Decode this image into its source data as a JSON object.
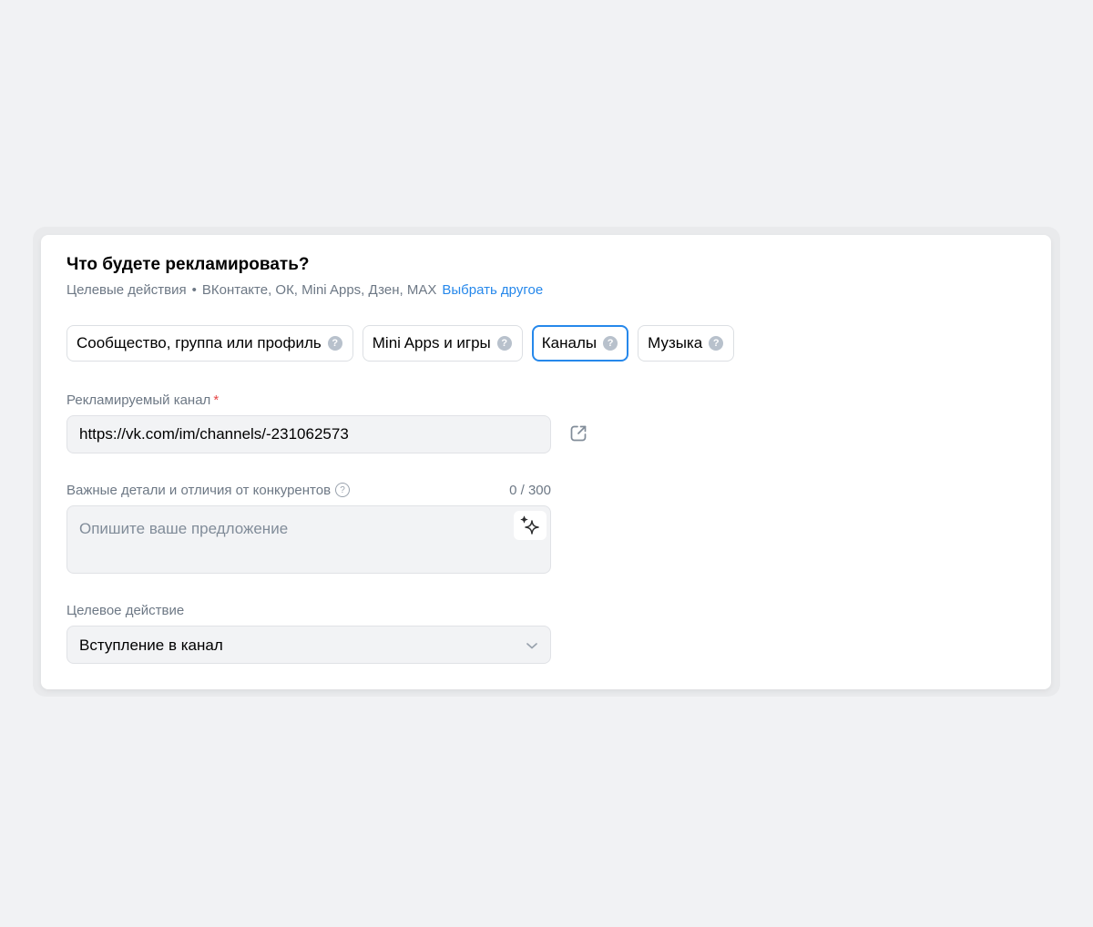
{
  "section": {
    "title": "Что будете рекламировать?",
    "subtitle_prefix": "Целевые действия",
    "subtitle_platforms": "ВКонтакте, ОК, Mini Apps, Дзен, MAX",
    "subtitle_link": "Выбрать другое"
  },
  "tabs": [
    {
      "label": "Сообщество, группа или профиль",
      "active": false
    },
    {
      "label": "Mini Apps и игры",
      "active": false
    },
    {
      "label": "Каналы",
      "active": true
    },
    {
      "label": "Музыка",
      "active": false
    }
  ],
  "channel_field": {
    "label": "Рекламируемый канал",
    "required_mark": "*",
    "value": "https://vk.com/im/channels/-231062573"
  },
  "details_field": {
    "label": "Важные детали и отличия от конкурентов",
    "counter": "0 / 300",
    "placeholder": "Опишите ваше предложение",
    "value": ""
  },
  "target_action": {
    "label": "Целевое действие",
    "value": "Вступление в канал"
  },
  "icons": {
    "help": "question-circle-icon",
    "external_link": "external-link-icon",
    "ai": "sparkle-icon",
    "dropdown": "chevron-down-icon"
  },
  "colors": {
    "accent": "#2688eb",
    "required": "#e64646",
    "muted_text": "#6d7885",
    "field_bg": "#f2f3f5",
    "page_bg": "#f1f2f4"
  }
}
